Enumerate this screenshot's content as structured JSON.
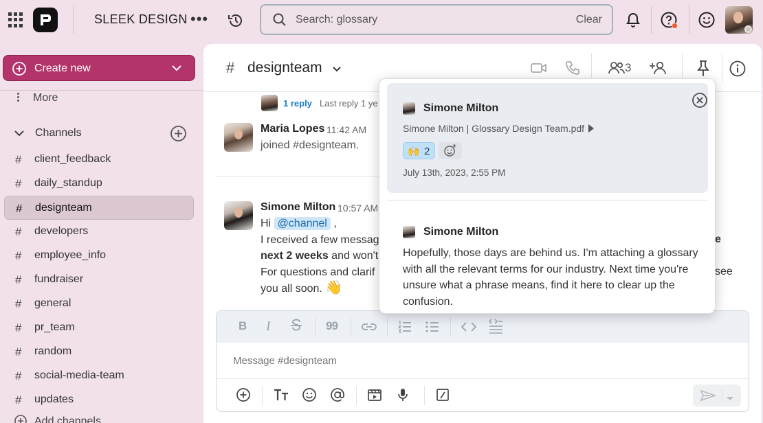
{
  "topbar": {
    "workspace_name": "SLEEK DESIGN",
    "more_label": "•••",
    "search_value": "Search: glossary",
    "search_clear": "Clear"
  },
  "sidebar": {
    "create_label": "Create new",
    "more_label": "More",
    "channels_heading": "Channels",
    "channels": [
      {
        "name": "client_feedback",
        "active": false
      },
      {
        "name": "daily_standup",
        "active": false
      },
      {
        "name": "designteam",
        "active": true
      },
      {
        "name": "developers",
        "active": false
      },
      {
        "name": "employee_info",
        "active": false
      },
      {
        "name": "fundraiser",
        "active": false
      },
      {
        "name": "general",
        "active": false
      },
      {
        "name": "pr_team",
        "active": false
      },
      {
        "name": "random",
        "active": false
      },
      {
        "name": "social-media-team",
        "active": false
      },
      {
        "name": "updates",
        "active": false
      }
    ],
    "add_channels_label": "Add channels"
  },
  "channel_header": {
    "hash": "#",
    "name": "designteam",
    "member_count": "3"
  },
  "messages": {
    "thread": {
      "reply_count": "1 reply",
      "last_reply": "Last reply 1 ye"
    },
    "maria": {
      "name": "Maria Lopes",
      "time": "11:42 AM",
      "text": "joined #designteam."
    },
    "simone": {
      "name": "Simone Milton",
      "time": "10:57 AM",
      "hi": "Hi",
      "mention": "@channel",
      "comma": ",",
      "line2": "I received a few messag",
      "line3_bold": "next 2 weeks",
      "line3_rest": " and won't",
      "line4": "For questions and clarif",
      "line5": "you all soon.",
      "emoji": "👋",
      "right_frag1": "e",
      "right_frag2": "see"
    }
  },
  "composer": {
    "placeholder": "Message #designteam",
    "quote_glyph": "99"
  },
  "popup": {
    "card_author": "Simone Milton",
    "file_line": "Simone Milton | Glossary Design Team.pdf",
    "reaction_emoji": "🙌",
    "reaction_count": "2",
    "date": "July 13th, 2023, 2:55 PM",
    "author2": "Simone Milton",
    "body": "Hopefully, those days are behind us. I'm attaching a glossary with all the relevant terms for our industry. Next time you're unsure what a phrase means, find it here to clear up the confusion."
  },
  "colors": {
    "app_background": "#f2e1ea",
    "create_button": "#b3346b",
    "active_channel": "#dcc8d2",
    "mention_bg": "#cfe6f8",
    "link_blue": "#1d7fc4",
    "notification_dot": "#f05a22"
  },
  "icons": [
    "apps-grid-icon",
    "logo-icon",
    "history-icon",
    "search-icon",
    "bell-icon",
    "help-icon",
    "smiley-icon",
    "video-icon",
    "phone-icon",
    "members-icon",
    "add-member-icon",
    "pin-icon",
    "info-icon",
    "close-icon",
    "send-icon"
  ]
}
